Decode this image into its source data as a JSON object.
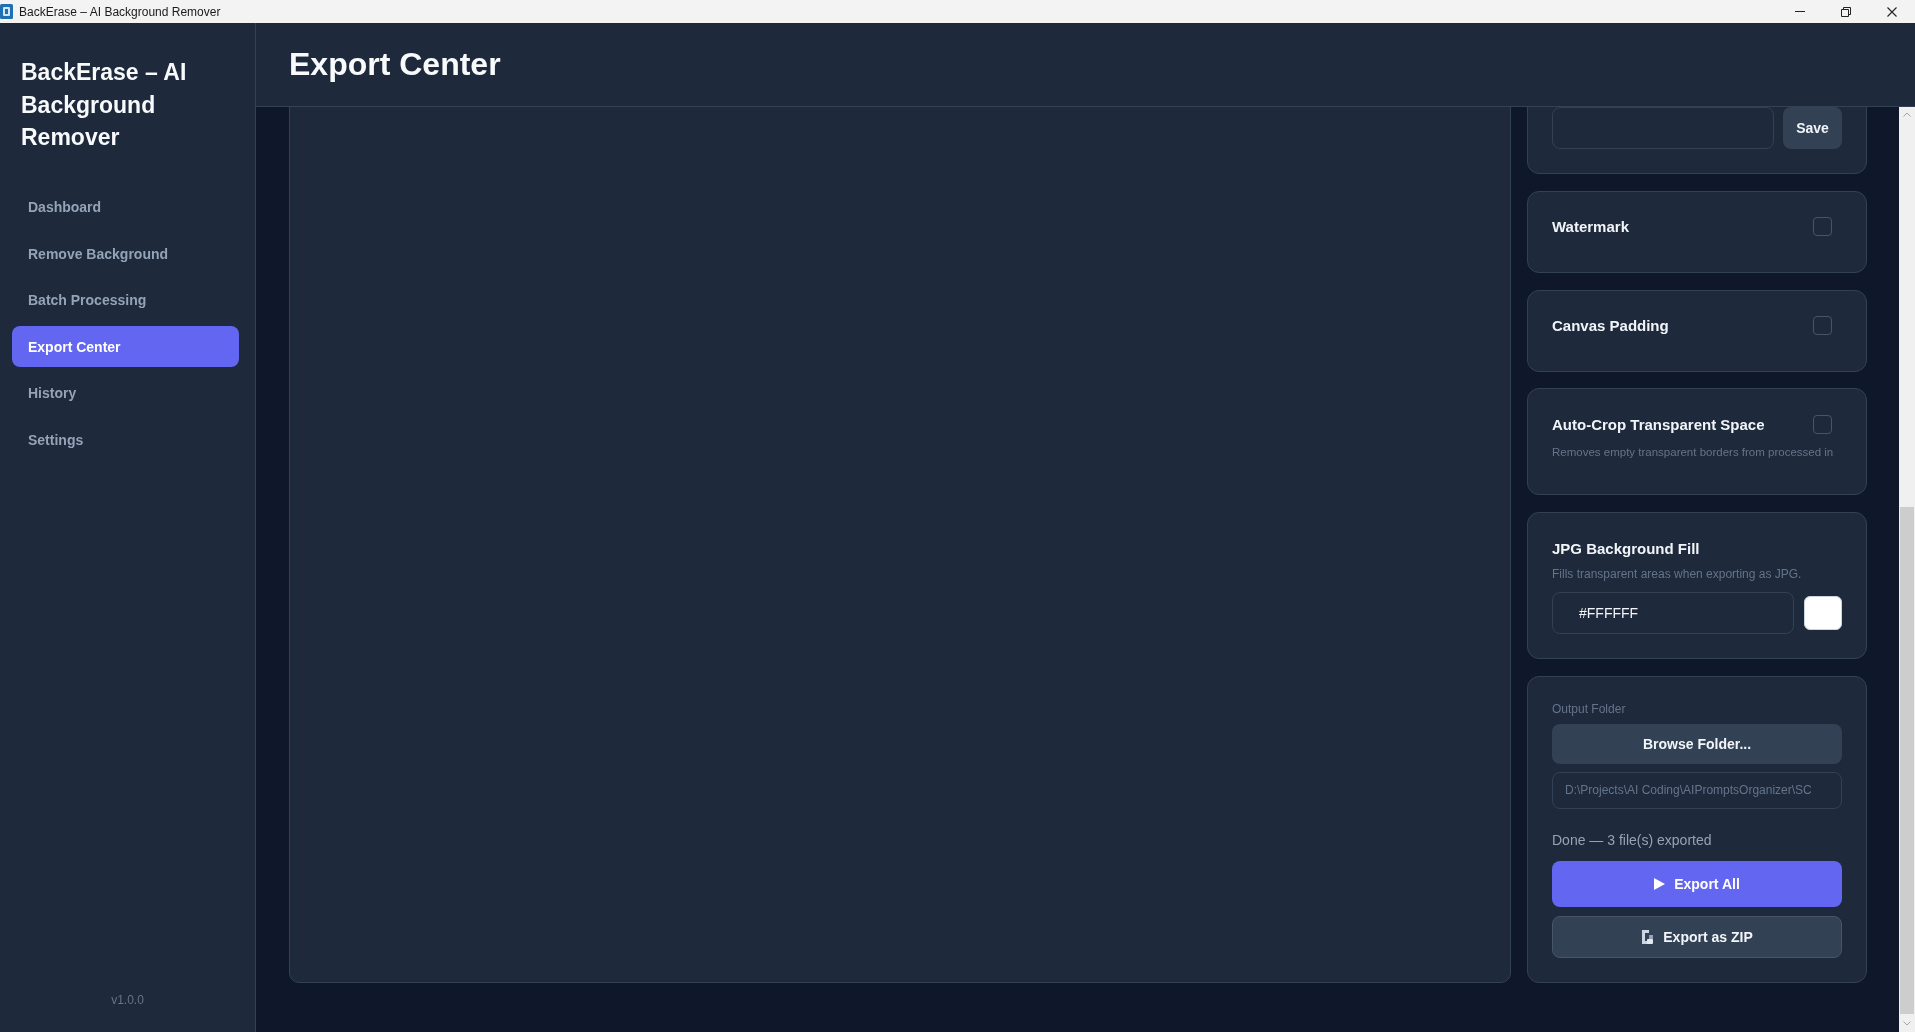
{
  "window": {
    "title": "BackErase – AI Background Remover"
  },
  "sidebar": {
    "brand": "BackErase – AI Background Remover",
    "items": [
      {
        "label": "Dashboard",
        "selected": false
      },
      {
        "label": "Remove Background",
        "selected": false
      },
      {
        "label": "Batch Processing",
        "selected": false
      },
      {
        "label": "Export Center",
        "selected": true
      },
      {
        "label": "History",
        "selected": false
      },
      {
        "label": "Settings",
        "selected": false
      }
    ],
    "version": "v1.0.0"
  },
  "header": {
    "title": "Export Center"
  },
  "settings_panel": {
    "preset_row": {
      "save_button": "Save"
    },
    "toggles": [
      {
        "label": "Watermark",
        "checked": false
      },
      {
        "label": "Canvas Padding",
        "checked": false
      },
      {
        "label": "Auto-Crop Transparent Space",
        "checked": false,
        "description": "Removes empty transparent borders from processed in"
      }
    ],
    "background_fill": {
      "title": "JPG Background Fill",
      "description": "Fills transparent areas when exporting as JPG.",
      "value": "#FFFFFF"
    },
    "output": {
      "label": "Output Folder",
      "browse_button": "Browse Folder...",
      "path": "D:\\Projects\\AI Coding\\AIPromptsOrganizer\\SC",
      "status": "Done — 3 file(s) exported",
      "actions": [
        {
          "label": "Export All",
          "kind": "primary"
        },
        {
          "label": "Export as ZIP",
          "kind": "zip"
        }
      ]
    }
  }
}
